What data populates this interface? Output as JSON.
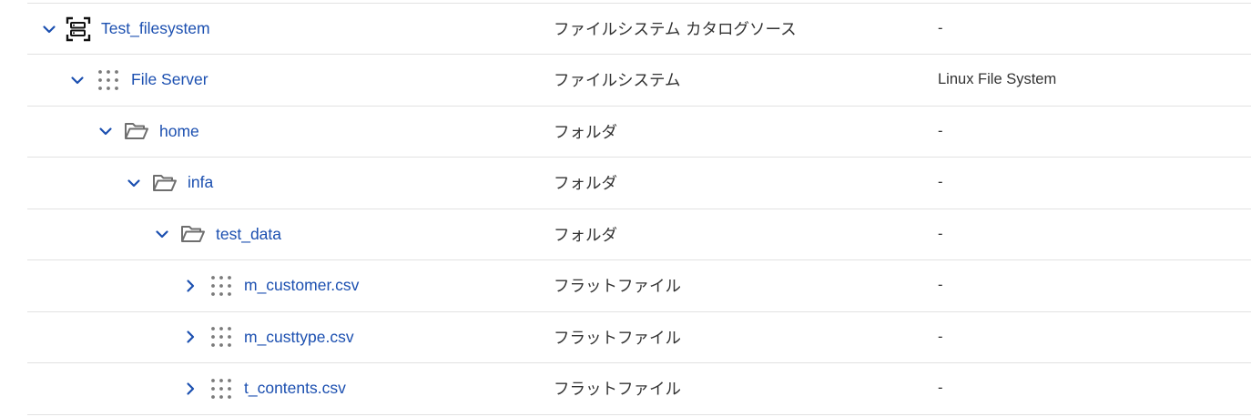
{
  "accent_color": "#1b4fb0",
  "tree": {
    "rows": [
      {
        "name": "Test_filesystem",
        "type": "ファイルシステム カタログソース",
        "detail": "-",
        "expanded": true,
        "icon": "catalog-source-icon"
      },
      {
        "name": "File Server",
        "type": "ファイルシステム",
        "detail": "Linux File System",
        "expanded": true,
        "icon": "dots-grid-icon"
      },
      {
        "name": "home",
        "type": "フォルダ",
        "detail": "-",
        "expanded": true,
        "icon": "open-folder-icon"
      },
      {
        "name": "infa",
        "type": "フォルダ",
        "detail": "-",
        "expanded": true,
        "icon": "open-folder-icon"
      },
      {
        "name": "test_data",
        "type": "フォルダ",
        "detail": "-",
        "expanded": true,
        "icon": "open-folder-icon"
      },
      {
        "name": "m_customer.csv",
        "type": "フラットファイル",
        "detail": "-",
        "expanded": false,
        "icon": "dots-grid-icon"
      },
      {
        "name": "m_custtype.csv",
        "type": "フラットファイル",
        "detail": "-",
        "expanded": false,
        "icon": "dots-grid-icon"
      },
      {
        "name": "t_contents.csv",
        "type": "フラットファイル",
        "detail": "-",
        "expanded": false,
        "icon": "dots-grid-icon"
      }
    ]
  }
}
